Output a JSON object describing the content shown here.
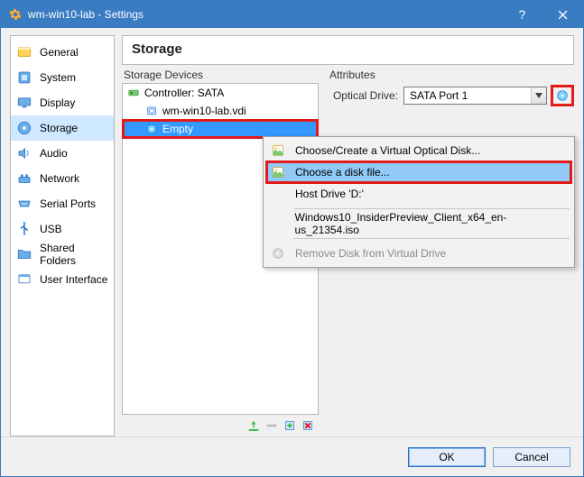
{
  "window": {
    "title": "wm-win10-lab - Settings"
  },
  "sidebar": {
    "items": [
      {
        "label": "General",
        "icon": "general"
      },
      {
        "label": "System",
        "icon": "system"
      },
      {
        "label": "Display",
        "icon": "display"
      },
      {
        "label": "Storage",
        "icon": "storage",
        "selected": true
      },
      {
        "label": "Audio",
        "icon": "audio"
      },
      {
        "label": "Network",
        "icon": "network"
      },
      {
        "label": "Serial Ports",
        "icon": "serial"
      },
      {
        "label": "USB",
        "icon": "usb"
      },
      {
        "label": "Shared Folders",
        "icon": "folders"
      },
      {
        "label": "User Interface",
        "icon": "ui"
      }
    ]
  },
  "page": {
    "title": "Storage",
    "storage_devices_label": "Storage Devices",
    "attributes_label": "Attributes",
    "controller": "Controller: SATA",
    "disk1": "wm-win10-lab.vdi",
    "disk2": "Empty",
    "optical_drive_label": "Optical Drive:",
    "optical_drive_value": "SATA Port 1"
  },
  "menu": {
    "item0": "Choose/Create a Virtual Optical Disk...",
    "item1": "Choose a disk file...",
    "item2": "Host Drive 'D:'",
    "item3": "Windows10_InsiderPreview_Client_x64_en-us_21354.iso",
    "item4": "Remove Disk from Virtual Drive"
  },
  "footer": {
    "ok": "OK",
    "cancel": "Cancel"
  }
}
